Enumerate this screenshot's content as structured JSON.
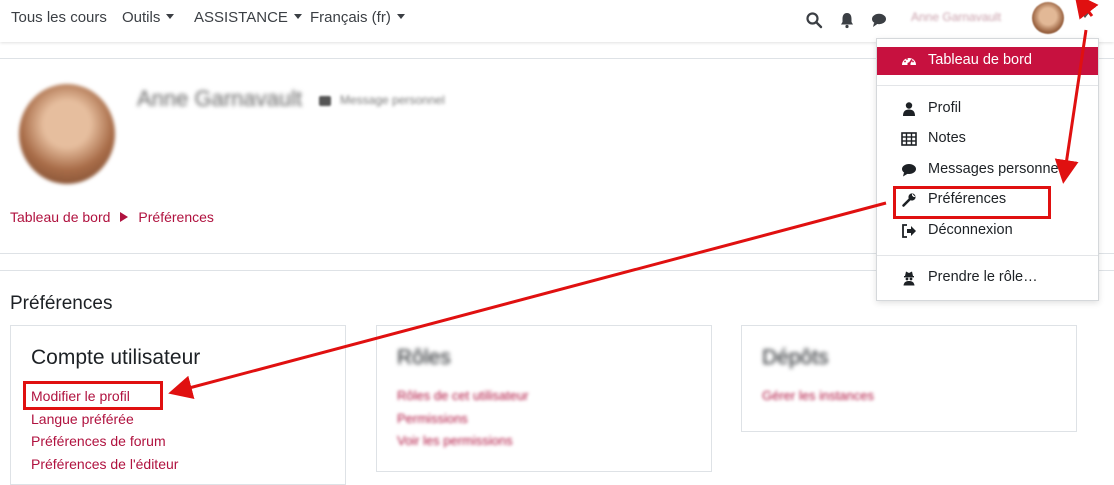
{
  "navbar": {
    "items": [
      {
        "label": "Tous les cours",
        "has_caret": false
      },
      {
        "label": "Outils",
        "has_caret": true
      },
      {
        "label": "ASSISTANCE",
        "has_caret": true
      },
      {
        "label": "Français (fr)",
        "has_caret": true
      }
    ],
    "icons": [
      "search-icon",
      "bell-icon",
      "chat-icon"
    ],
    "user_name": "Anne Garnavault"
  },
  "profile": {
    "name": "Anne Garnavault",
    "message_link": "Message personnel"
  },
  "breadcrumb": {
    "items": [
      "Tableau de bord",
      "Préférences"
    ]
  },
  "main": {
    "section_title": "Préférences",
    "cards": [
      {
        "title": "Compte utilisateur",
        "links": [
          "Modifier le profil",
          "Langue préférée",
          "Préférences de forum",
          "Préférences de l'éditeur"
        ]
      },
      {
        "title": "Rôles",
        "links": [
          "Rôles de cet utilisateur",
          "Permissions",
          "Voir les permissions"
        ]
      },
      {
        "title": "Dépôts",
        "links": [
          "Gérer les instances"
        ]
      }
    ]
  },
  "user_menu": {
    "items": [
      {
        "label": "Tableau de bord",
        "icon": "dashboard-icon",
        "active": true
      },
      {
        "label": "Profil",
        "icon": "user-icon",
        "active": false
      },
      {
        "label": "Notes",
        "icon": "table-icon",
        "active": false
      },
      {
        "label": "Messages personnels",
        "icon": "comment-icon",
        "active": false
      },
      {
        "label": "Préférences",
        "icon": "wrench-icon",
        "active": false
      },
      {
        "label": "Déconnexion",
        "icon": "sign-out-icon",
        "active": false
      },
      {
        "label": "Prendre le rôle…",
        "icon": "user-secret-icon",
        "active": false
      }
    ]
  },
  "colors": {
    "brand": "#b0123f",
    "menu_active": "#c7113f",
    "annotation": "#e01010"
  }
}
